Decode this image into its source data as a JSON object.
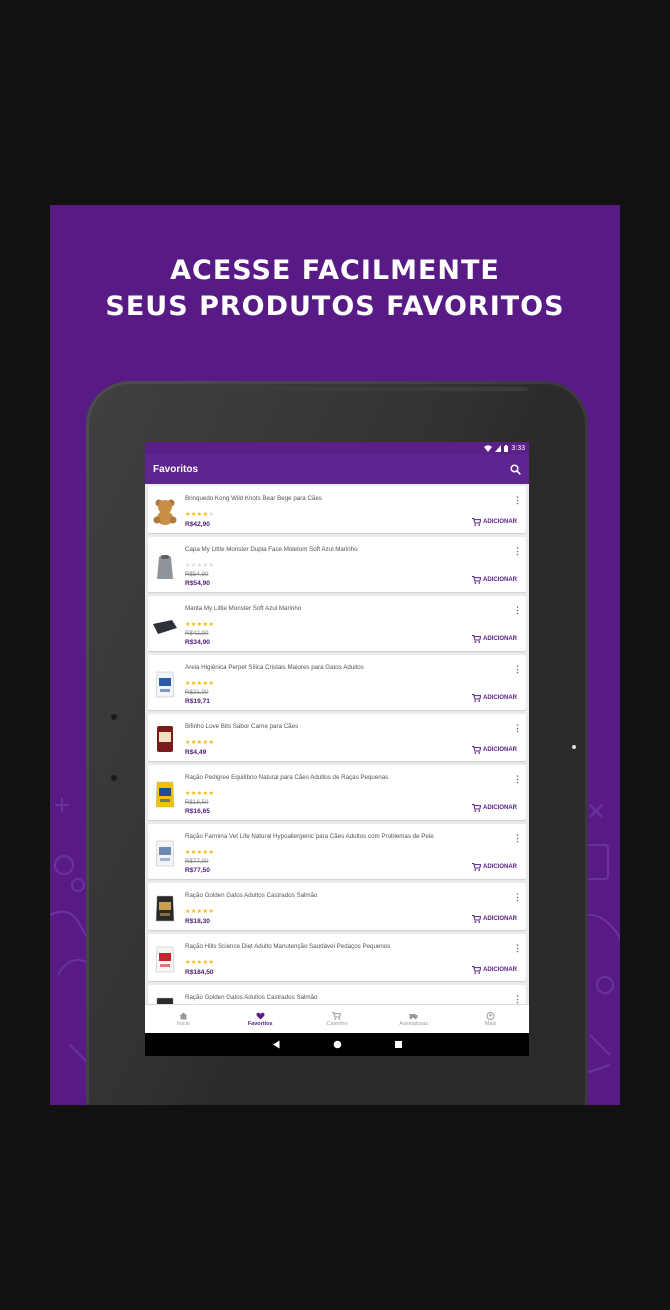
{
  "headline": {
    "line1": "ACESSE FACILMENTE",
    "line2": "SEUS PRODUTOS FAVORITOS"
  },
  "status": {
    "time": "3:33"
  },
  "appbar": {
    "title": "Favoritos"
  },
  "add_label": "ADICIONAR",
  "products": [
    {
      "name": "Brinquedo Kong Wild Knots Bear Bege para Cães",
      "rating": 3.5,
      "old_price": "",
      "price": "R$42,90",
      "icon": "teddy-bear-icon"
    },
    {
      "name": "Capa My Little Monster Dupla Face Moletom Soft Azul Marinho",
      "rating": 0,
      "old_price": "R$54,90",
      "price": "R$54,90",
      "icon": "pet-coat-icon"
    },
    {
      "name": "Manta My Little Monster Soft Azul Marinho",
      "rating": 5,
      "old_price": "R$42,90",
      "price": "R$34,90",
      "icon": "blanket-icon"
    },
    {
      "name": "Areia Higiênica Perpet Sílica Cristais Maiores para Gatos Adultos",
      "rating": 4.5,
      "old_price": "R$21,90",
      "price": "R$19,71",
      "icon": "litter-bag-icon"
    },
    {
      "name": "Bifinho Love Bits Sabor Carne para Cães",
      "rating": 5,
      "old_price": "",
      "price": "R$4,49",
      "icon": "snack-pack-icon"
    },
    {
      "name": "Ração Pedigree Equilíbrio Natural para Cães Adultos de Raças Pequenas",
      "rating": 5,
      "old_price": "R$18,50",
      "price": "R$16,65",
      "icon": "dog-food-bag-icon"
    },
    {
      "name": "Ração Farmina Vet Life Natural Hypoallergenic para Cães Adultos com Problemas de Pele",
      "rating": 4.5,
      "old_price": "R$77,90",
      "price": "R$77,50",
      "icon": "vet-food-bag-icon"
    },
    {
      "name": "Ração Golden Gatos Adultos Castrados Salmão",
      "rating": 5,
      "old_price": "",
      "price": "R$18,30",
      "icon": "cat-food-bag-icon"
    },
    {
      "name": "Ração Hills Science Diet Adulto Manutenção Saudável Pedaços Pequenos",
      "rating": 5,
      "old_price": "",
      "price": "R$184,50",
      "icon": "hills-food-bag-icon"
    },
    {
      "name": "Ração Golden Gatos Adultos Castrados Salmão",
      "rating": 0,
      "old_price": "",
      "price": "",
      "icon": "cat-food-bag-icon"
    }
  ],
  "bottom_nav": [
    {
      "label": "Início",
      "icon": "home-icon",
      "active": false
    },
    {
      "label": "Favoritos",
      "icon": "heart-icon",
      "active": true
    },
    {
      "label": "Carrinho",
      "icon": "cart-icon",
      "active": false
    },
    {
      "label": "Assinaturas",
      "icon": "subscription-icon",
      "active": false
    },
    {
      "label": "Mais",
      "icon": "more-user-icon",
      "active": false
    }
  ],
  "colors": {
    "brand": "#581b86",
    "appbar": "#5e2490",
    "star": "#f2b600",
    "price": "#4b1a78"
  }
}
